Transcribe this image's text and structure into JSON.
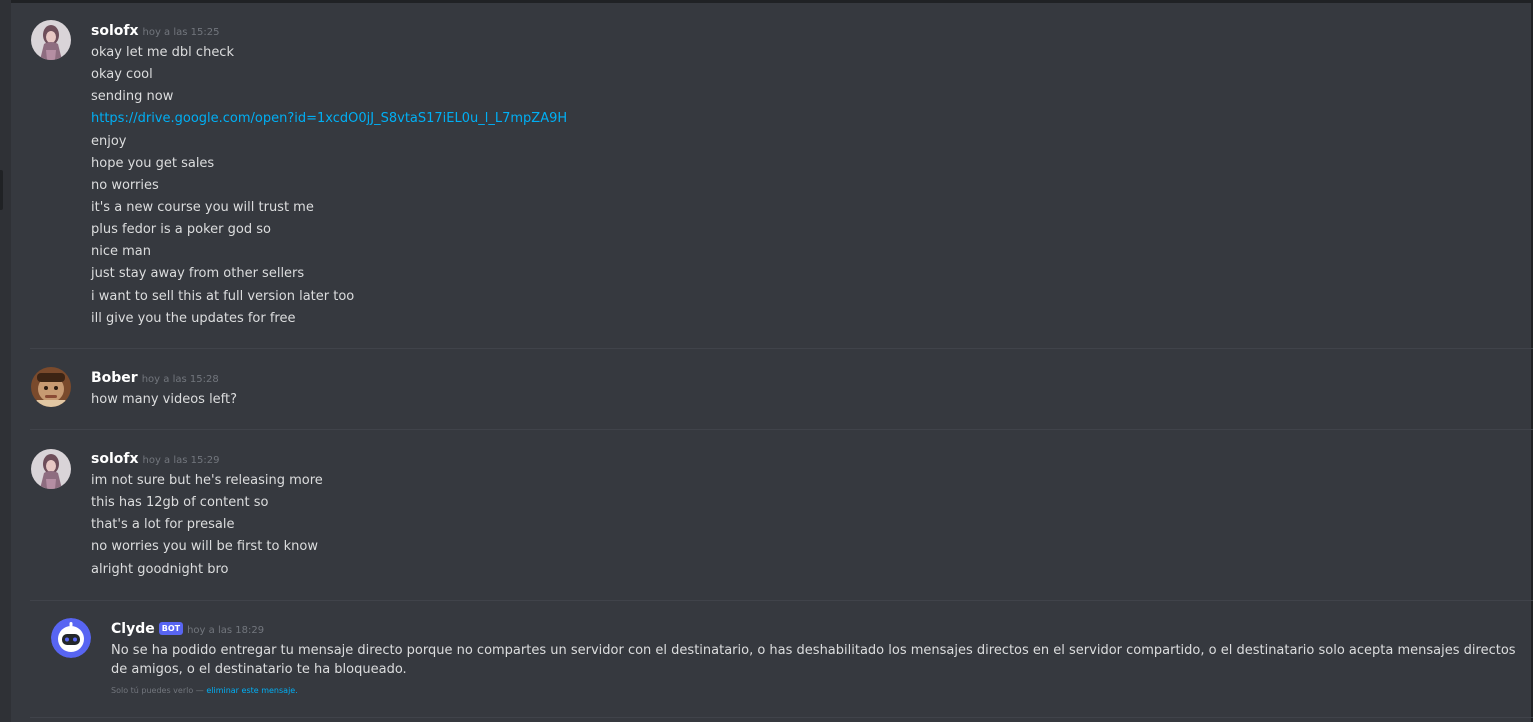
{
  "messages": [
    {
      "author": "solofx",
      "timestamp": "hoy a las 15:25",
      "avatar": "user-avatar",
      "lines": [
        {
          "text": "okay let me dbl check",
          "link": false
        },
        {
          "text": "okay cool",
          "link": false
        },
        {
          "text": "sending now",
          "link": false
        },
        {
          "text": "https://drive.google.com/open?id=1xcdO0jJ_S8vtaS17iEL0u_l_L7mpZA9H",
          "link": true
        },
        {
          "text": "enjoy",
          "link": false
        },
        {
          "text": "hope you get sales",
          "link": false
        },
        {
          "text": "no worries",
          "link": false
        },
        {
          "text": "it's a new course you will trust me",
          "link": false
        },
        {
          "text": "plus fedor is a poker god so",
          "link": false
        },
        {
          "text": "nice man",
          "link": false
        },
        {
          "text": "just stay away from other sellers",
          "link": false
        },
        {
          "text": "i want to sell this at full version later too",
          "link": false
        },
        {
          "text": "ill give you the updates for free",
          "link": false
        }
      ]
    },
    {
      "author": "Bober",
      "timestamp": "hoy a las 15:28",
      "avatar": "user-avatar",
      "lines": [
        {
          "text": "how many videos left?",
          "link": false
        }
      ]
    },
    {
      "author": "solofx",
      "timestamp": "hoy a las 15:29",
      "avatar": "user-avatar",
      "lines": [
        {
          "text": "im not sure but he's releasing more",
          "link": false
        },
        {
          "text": "this has 12gb of content so",
          "link": false
        },
        {
          "text": "that's a lot for presale",
          "link": false
        },
        {
          "text": "no worries you will be first to know",
          "link": false
        },
        {
          "text": "alright goodnight bro",
          "link": false
        }
      ]
    }
  ],
  "clyde": {
    "author": "Clyde",
    "bot_tag": "BOT",
    "timestamp": "hoy a las 18:29",
    "avatar": "robot-avatar",
    "text": "No se ha podido entregar tu mensaje directo porque no compartes un servidor con el destinatario, o has deshabilitado los mensajes directos en el servidor compartido, o el destinatario solo acepta mensajes directos de amigos, o el destinatario te ha bloqueado.",
    "ephemeral_note": "Solo tú puedes verlo —",
    "delete_link": "eliminar este mensaje."
  },
  "colors": {
    "background": "#36393f",
    "text": "#dcddde",
    "link": "#00aff4",
    "muted": "#72767d",
    "bot_tag": "#5865f2"
  }
}
